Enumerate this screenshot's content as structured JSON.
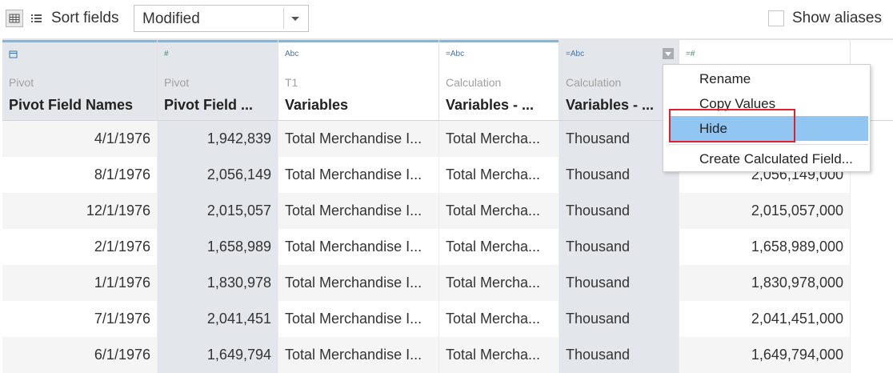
{
  "toolbar": {
    "grid_view_icon": "grid-view-icon",
    "list_view_icon": "list-view-icon",
    "sort_label": "Sort fields",
    "sort_value": "Modified",
    "show_aliases_label": "Show aliases"
  },
  "columns": [
    {
      "type_icon": "Calendar",
      "source": "Pivot",
      "name": "Pivot Field Names",
      "highlight": "pivot"
    },
    {
      "type_icon": "#",
      "source": "Pivot",
      "name": "Pivot Field ...",
      "highlight": "pivot"
    },
    {
      "type_icon": "Abc",
      "source": "T1",
      "name": "Variables",
      "highlight": "none"
    },
    {
      "type_icon": "=Abc",
      "source": "Calculation",
      "name": "Variables - ...",
      "highlight": "none"
    },
    {
      "type_icon": "=Abc",
      "source": "Calculation",
      "name": "Variables - ...",
      "highlight": "selected"
    },
    {
      "type_icon": "=#",
      "source": "",
      "name": "",
      "highlight": "none"
    }
  ],
  "rows": [
    [
      "4/1/1976",
      "1,942,839",
      "Total Merchandise I...",
      "Total Mercha...",
      "Thousand",
      ""
    ],
    [
      "8/1/1976",
      "2,056,149",
      "Total Merchandise I...",
      "Total Mercha...",
      "Thousand",
      "2,056,149,000"
    ],
    [
      "12/1/1976",
      "2,015,057",
      "Total Merchandise I...",
      "Total Mercha...",
      "Thousand",
      "2,015,057,000"
    ],
    [
      "2/1/1976",
      "1,658,989",
      "Total Merchandise I...",
      "Total Mercha...",
      "Thousand",
      "1,658,989,000"
    ],
    [
      "1/1/1976",
      "1,830,978",
      "Total Merchandise I...",
      "Total Mercha...",
      "Thousand",
      "1,830,978,000"
    ],
    [
      "7/1/1976",
      "2,041,451",
      "Total Merchandise I...",
      "Total Mercha...",
      "Thousand",
      "2,041,451,000"
    ],
    [
      "6/1/1976",
      "1,649,794",
      "Total Merchandise I...",
      "Total Mercha...",
      "Thousand",
      "1,649,794,000"
    ]
  ],
  "context_menu": {
    "items": [
      "Rename",
      "Copy Values",
      "Hide",
      "Create Calculated Field..."
    ],
    "active_item": "Hide"
  },
  "colors": {
    "pivot_column_bg": "#e3e7eb",
    "selected_column_bg": "#e3e7eb",
    "highlight_menu_bg": "#91c6f3",
    "annotation_border": "#e0202a",
    "pivot_topbar": "#8fb3cc",
    "type_green": "#2e9a6a",
    "type_blue": "#3a76b0"
  }
}
